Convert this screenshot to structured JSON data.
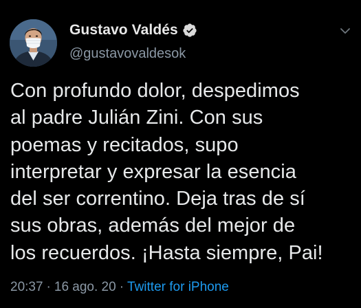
{
  "author": {
    "display_name": "Gustavo Valdés",
    "handle": "@gustavovaldesok",
    "verified": true
  },
  "icons": {
    "verified": "verified-badge-icon",
    "menu": "chevron-down-icon"
  },
  "tweet": {
    "text": "Con profundo dolor, despedimos\nal padre Julián Zini. Con sus\npoemas y recitados, supo\ninterpretar y expresar la esencia\ndel ser correntino. Deja tras de sí\nsus obras, además del mejor de\nlos recuerdos. ¡Hasta siempre, Pai!",
    "time": "20:37",
    "date": "16 ago. 20",
    "separator": "·",
    "source": "Twitter for iPhone"
  },
  "colors": {
    "background": "#000000",
    "text": "#e7e9ea",
    "secondary": "#8b98a5",
    "link": "#1d9bf0"
  }
}
